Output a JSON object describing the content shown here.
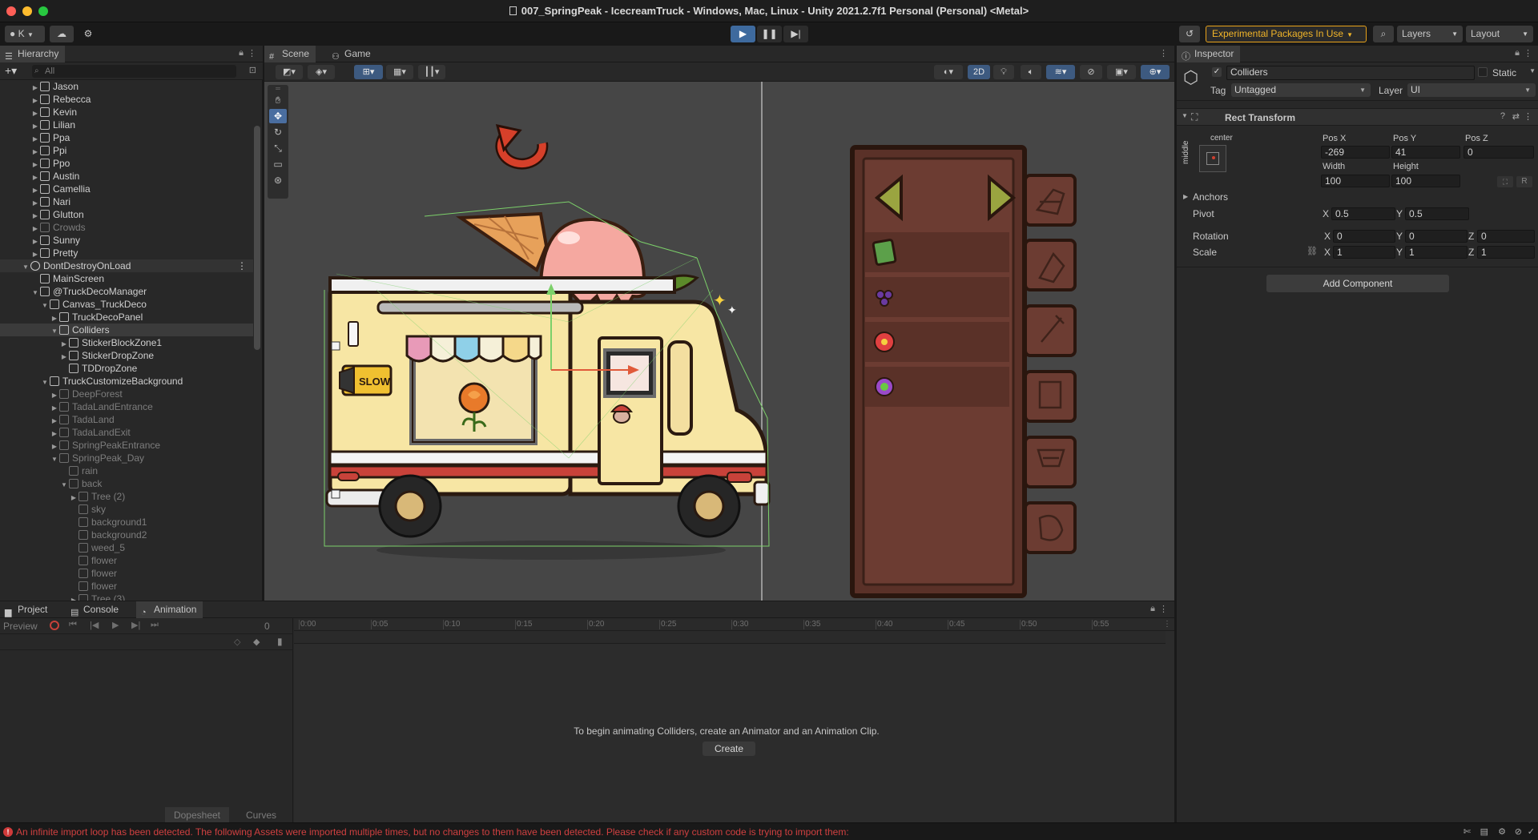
{
  "window": {
    "title": "007_SpringPeak - IcecreamTruck - Windows, Mac, Linux - Unity 2021.2.7f1 Personal (Personal) <Metal>"
  },
  "toolbar": {
    "account_label": "K",
    "experimental_label": "Experimental Packages In Use",
    "layers_label": "Layers",
    "layout_label": "Layout"
  },
  "hierarchy": {
    "tab_label": "Hierarchy",
    "search_placeholder": "All",
    "rows": [
      {
        "label": "Jason",
        "indent": 1,
        "arrow": "▶",
        "dim": false
      },
      {
        "label": "Rebecca",
        "indent": 1,
        "arrow": "▶",
        "dim": false
      },
      {
        "label": "Kevin",
        "indent": 1,
        "arrow": "▶",
        "dim": false
      },
      {
        "label": "Lilian",
        "indent": 1,
        "arrow": "▶",
        "dim": false
      },
      {
        "label": "Ppa",
        "indent": 1,
        "arrow": "▶",
        "dim": false
      },
      {
        "label": "Ppi",
        "indent": 1,
        "arrow": "▶",
        "dim": false
      },
      {
        "label": "Ppo",
        "indent": 1,
        "arrow": "▶",
        "dim": false
      },
      {
        "label": "Austin",
        "indent": 1,
        "arrow": "▶",
        "dim": false
      },
      {
        "label": "Camellia",
        "indent": 1,
        "arrow": "▶",
        "dim": false
      },
      {
        "label": "Nari",
        "indent": 1,
        "arrow": "▶",
        "dim": false
      },
      {
        "label": "Glutton",
        "indent": 1,
        "arrow": "▶",
        "dim": false
      },
      {
        "label": "Crowds",
        "indent": 1,
        "arrow": "▶",
        "dim": true
      },
      {
        "label": "Sunny",
        "indent": 1,
        "arrow": "▶",
        "dim": false
      },
      {
        "label": "Pretty",
        "indent": 1,
        "arrow": "▶",
        "dim": false
      },
      {
        "label": "DontDestroyOnLoad",
        "indent": 0,
        "arrow": "▼",
        "dim": false,
        "scene": true
      },
      {
        "label": "MainScreen",
        "indent": 1,
        "arrow": "",
        "dim": false
      },
      {
        "label": "@TruckDecoManager",
        "indent": 1,
        "arrow": "▼",
        "dim": false
      },
      {
        "label": "Canvas_TruckDeco",
        "indent": 2,
        "arrow": "▼",
        "dim": false
      },
      {
        "label": "TruckDecoPanel",
        "indent": 3,
        "arrow": "▶",
        "dim": false
      },
      {
        "label": "Colliders",
        "indent": 3,
        "arrow": "▼",
        "dim": false,
        "selected": true
      },
      {
        "label": "StickerBlockZone1",
        "indent": 4,
        "arrow": "▶",
        "dim": false
      },
      {
        "label": "StickerDropZone",
        "indent": 4,
        "arrow": "▶",
        "dim": false
      },
      {
        "label": "TDDropZone",
        "indent": 4,
        "arrow": "",
        "dim": false
      },
      {
        "label": "TruckCustomizeBackground",
        "indent": 2,
        "arrow": "▼",
        "dim": false
      },
      {
        "label": "DeepForest",
        "indent": 3,
        "arrow": "▶",
        "dim": true
      },
      {
        "label": "TadaLandEntrance",
        "indent": 3,
        "arrow": "▶",
        "dim": true
      },
      {
        "label": "TadaLand",
        "indent": 3,
        "arrow": "▶",
        "dim": true
      },
      {
        "label": "TadaLandExit",
        "indent": 3,
        "arrow": "▶",
        "dim": true
      },
      {
        "label": "SpringPeakEntrance",
        "indent": 3,
        "arrow": "▶",
        "dim": true
      },
      {
        "label": "SpringPeak_Day",
        "indent": 3,
        "arrow": "▼",
        "dim": true
      },
      {
        "label": "rain",
        "indent": 4,
        "arrow": "",
        "dim": true
      },
      {
        "label": "back",
        "indent": 4,
        "arrow": "▼",
        "dim": true
      },
      {
        "label": "Tree (2)",
        "indent": 5,
        "arrow": "▶",
        "dim": true
      },
      {
        "label": "sky",
        "indent": 5,
        "arrow": "",
        "dim": true
      },
      {
        "label": "background1",
        "indent": 5,
        "arrow": "",
        "dim": true
      },
      {
        "label": "background2",
        "indent": 5,
        "arrow": "",
        "dim": true
      },
      {
        "label": "weed_5",
        "indent": 5,
        "arrow": "",
        "dim": true
      },
      {
        "label": "flower",
        "indent": 5,
        "arrow": "",
        "dim": true
      },
      {
        "label": "flower",
        "indent": 5,
        "arrow": "",
        "dim": true
      },
      {
        "label": "flower",
        "indent": 5,
        "arrow": "",
        "dim": true
      },
      {
        "label": "Tree (3)",
        "indent": 5,
        "arrow": "▶",
        "dim": true
      }
    ]
  },
  "scene": {
    "tab_scene": "Scene",
    "tab_game": "Game",
    "btn_2d": "2D"
  },
  "inspector": {
    "tab_label": "Inspector",
    "object_name": "Colliders",
    "static_label": "Static",
    "tag_label": "Tag",
    "tag_value": "Untagged",
    "layer_label": "Layer",
    "layer_value": "UI",
    "component_title": "Rect Transform",
    "anchor_h": "center",
    "anchor_v": "middle",
    "pos_x_label": "Pos X",
    "pos_y_label": "Pos Y",
    "pos_z_label": "Pos Z",
    "pos_x": "-269",
    "pos_y": "41",
    "pos_z": "0",
    "width_label": "Width",
    "height_label": "Height",
    "width": "100",
    "height": "100",
    "r_label": "R",
    "anchors_label": "Anchors",
    "pivot_label": "Pivot",
    "pivot_x": "0.5",
    "pivot_y": "0.5",
    "rotation_label": "Rotation",
    "rot_x": "0",
    "rot_y": "0",
    "rot_z": "0",
    "scale_label": "Scale",
    "scale_x": "1",
    "scale_y": "1",
    "scale_z": "1",
    "x": "X",
    "y": "Y",
    "z": "Z",
    "add_component": "Add Component"
  },
  "bottom": {
    "tab_project": "Project",
    "tab_console": "Console",
    "tab_animation": "Animation",
    "preview_label": "Preview",
    "frame_value": "0",
    "ruler_labels": [
      "0:00",
      "0:05",
      "0:10",
      "0:15",
      "0:20",
      "0:25",
      "0:30",
      "0:35",
      "0:40",
      "0:45",
      "0:50",
      "0:55"
    ],
    "message": "To begin animating Colliders, create an Animator and an Animation Clip.",
    "create_label": "Create",
    "dopesheet_label": "Dopesheet",
    "curves_label": "Curves"
  },
  "status": {
    "message": "An infinite import loop has been detected. The following Assets were imported multiple times, but no changes to them have been detected. Please check if any custom code is trying to import them:"
  },
  "truck": {
    "sign_text": "SLOW"
  }
}
